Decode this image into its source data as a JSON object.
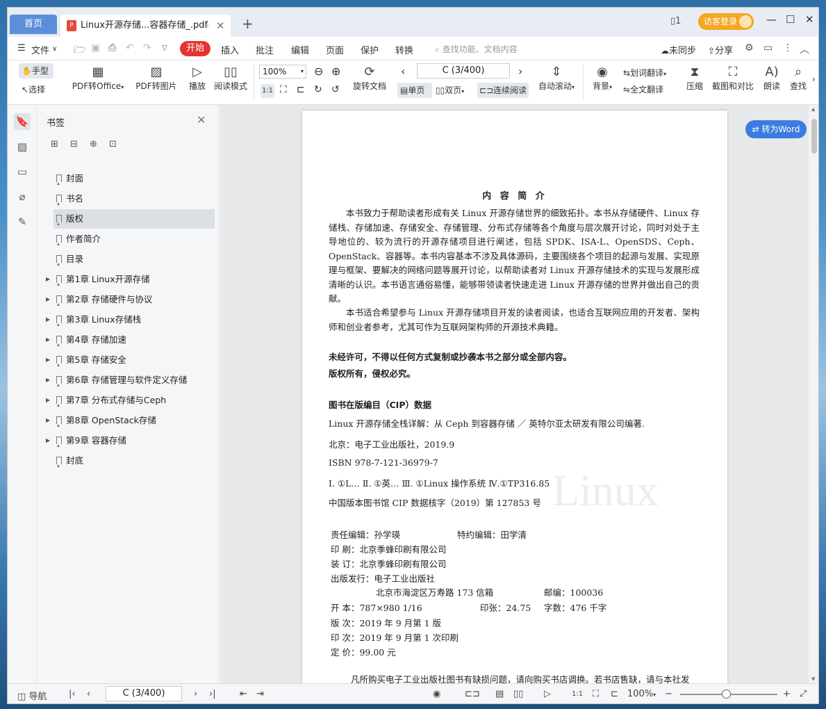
{
  "titlebar": {
    "home_tab": "首页",
    "doc_tab": "Linux开源存储...容器存储_.pdf",
    "login": "访客登录"
  },
  "menu": {
    "file": "文件",
    "start": "开始",
    "items": [
      "插入",
      "批注",
      "编辑",
      "页面",
      "保护",
      "转换"
    ],
    "search_placeholder": "查找功能、文档内容",
    "unsync": "未同步",
    "share": "分享"
  },
  "ribbon": {
    "hand": "手型",
    "select": "选择",
    "pdf_to_office": "PDF转Office",
    "pdf_to_image": "PDF转图片",
    "play": "播放",
    "read_mode": "阅读模式",
    "zoom": "100%",
    "rotate": "旋转文档",
    "page_indicator": "C (3/400)",
    "single": "单页",
    "double": "双页",
    "continuous": "连续阅读",
    "auto_scroll": "自动滚动",
    "background": "背景",
    "word_translate": "划词翻译",
    "full_translate": "全文翻译",
    "compress": "压缩",
    "screenshot_compare": "截图和对比",
    "read_aloud": "朗读",
    "find": "查找"
  },
  "panel": {
    "title": "书签",
    "bookmarks": [
      {
        "label": "封面",
        "expandable": false
      },
      {
        "label": "书名",
        "expandable": false
      },
      {
        "label": "版权",
        "expandable": false,
        "selected": true
      },
      {
        "label": "作者简介",
        "expandable": false
      },
      {
        "label": "目录",
        "expandable": false
      },
      {
        "label": "第1章  Linux开源存储",
        "expandable": true
      },
      {
        "label": "第2章  存储硬件与协议",
        "expandable": true
      },
      {
        "label": "第3章  Linux存储栈",
        "expandable": true
      },
      {
        "label": "第4章  存储加速",
        "expandable": true
      },
      {
        "label": "第5章  存储安全",
        "expandable": true
      },
      {
        "label": "第6章  存储管理与软件定义存储",
        "expandable": true
      },
      {
        "label": "第7章  分布式存储与Ceph",
        "expandable": true
      },
      {
        "label": "第8章  OpenStack存储",
        "expandable": true
      },
      {
        "label": "第9章  容器存储",
        "expandable": true
      },
      {
        "label": "封底",
        "expandable": false
      }
    ]
  },
  "doc": {
    "to_word": "转为Word",
    "heading": "内 容 简 介",
    "para1": "本书致力于帮助读者形成有关 Linux 开源存储世界的细致拓扑。本书从存储硬件、Linux 存储栈、存储加速、存储安全、存储管理、分布式存储等各个角度与层次展开讨论，同时对处于主导地位的、较为流行的开源存储项目进行阐述，包括 SPDK、ISA-L、OpenSDS、Ceph、OpenStack、容器等。本书内容基本不涉及具体源码，主要围绕各个项目的起源与发展、实现原理与框架、要解决的网络问题等展开讨论，以帮助读者对 Linux 开源存储技术的实现与发展形成清晰的认识。本书语言通俗易懂，能够带领读者快速走进 Linux 开源存储的世界并做出自己的贡献。",
    "para2": "本书适合希望参与 Linux 开源存储项目开发的读者阅读，也适合互联网应用的开发者、架构师和创业者参考，尤其可作为互联网架构师的开源技术典籍。",
    "warn1": "未经许可，不得以任何方式复制或抄袭本书之部分或全部内容。",
    "warn2": "版权所有，侵权必究。",
    "cip_title": "图书在版编目（CIP）数据",
    "cip1": "Linux 开源存储全栈详解：从 Ceph 到容器存储 ／ 英特尔亚太研发有限公司编著.",
    "cip2": "北京：电子工业出版社，2019.9",
    "cip3": "ISBN 978-7-121-36979-7",
    "cip4": "Ⅰ. ①L…  Ⅱ. ①英…  Ⅲ. ①Linux 操作系统  Ⅳ.①TP316.85",
    "cip5": "中国版本图书馆 CIP 数据核字（2019）第 127853 号",
    "editor": "责任编辑：孙学瑛",
    "special_editor": "特约编辑：田学清",
    "printer": "印    刷：北京季蜂印刷有限公司",
    "binder": "装    订：北京季蜂印刷有限公司",
    "publisher": "出版发行：电子工业出版社",
    "address": "北京市海淀区万寿路 173 信箱",
    "postcode": "邮编：100036",
    "format": "开    本：787×980      1/16",
    "sheets": "印张：24.75",
    "words": "字数：476 千字",
    "edition": "版    次：2019 年 9 月第 1 版",
    "printing": "印    次：2019 年 9 月第 1 次印刷",
    "price": "定    价：99.00 元",
    "footer": "凡所购买电子工业出版社图书有缺损问题，请向购买书店调换。若书店售缺，请与本社发",
    "watermark": "Linux"
  },
  "status": {
    "nav": "导航",
    "page": "C (3/400)",
    "zoom": "100%"
  },
  "colors": {
    "accent_blue": "#3c7ce0",
    "start_red": "#e5342f",
    "login_orange": "#f5a623",
    "home_tab": "#5b8fd9"
  }
}
